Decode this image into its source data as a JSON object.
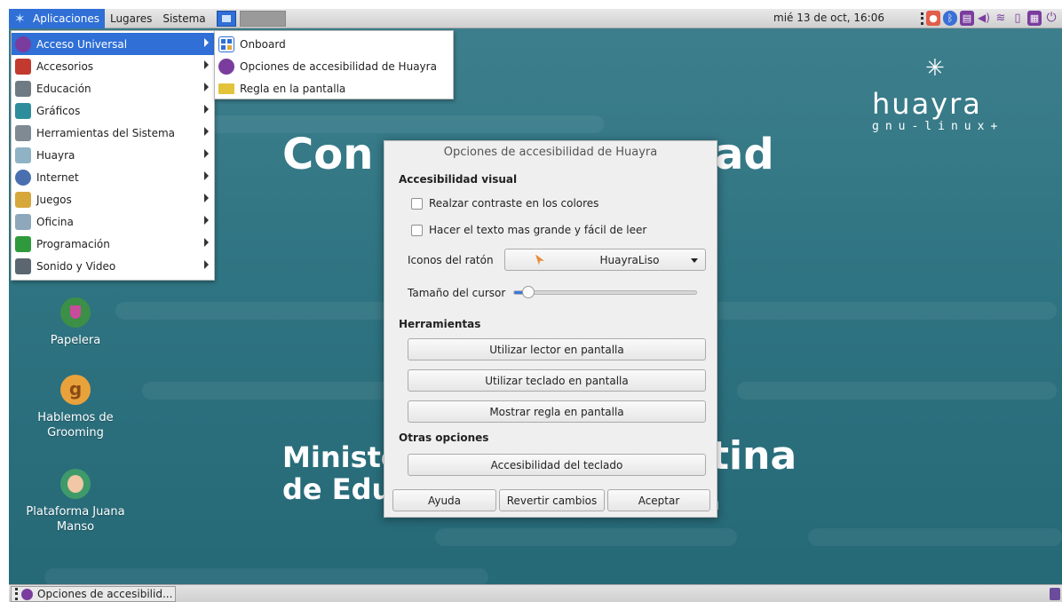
{
  "top_panel": {
    "menus": [
      "Aplicaciones",
      "Lugares",
      "Sistema"
    ],
    "clock": "mié 13 de oct, 16:06"
  },
  "desktop": {
    "banner_top_left": "Con",
    "banner_top_right": "ad",
    "banner_bottom_left_1": "Ministe",
    "banner_bottom_left_2": "de Edu",
    "banner_bottom_right": "tina",
    "banner_bottom_right_2": "a",
    "logo_word": "huayra",
    "logo_sub": "gnu-linux+",
    "icons": [
      {
        "label": "Papelera",
        "color": "#3c8f47"
      },
      {
        "label": "Hablemos de Grooming",
        "color": "#e9a23b"
      },
      {
        "label": "Plataforma Juana Manso",
        "color": "#3f9a6a"
      }
    ]
  },
  "apps_menu": {
    "items": [
      {
        "label": "Acceso Universal",
        "active": true,
        "icon": "universal-access-icon",
        "color": "#7a3d9e"
      },
      {
        "label": "Accesorios",
        "icon": "accessories-icon",
        "color": "#c23a2e"
      },
      {
        "label": "Educación",
        "icon": "education-icon",
        "color": "#6f7a83"
      },
      {
        "label": "Gráficos",
        "icon": "graphics-icon",
        "color": "#2e8d9a"
      },
      {
        "label": "Herramientas del Sistema",
        "icon": "system-tools-icon",
        "color": "#7f8a93"
      },
      {
        "label": "Huayra",
        "icon": "huayra-icon",
        "color": "#8fb3c4"
      },
      {
        "label": "Internet",
        "icon": "internet-icon",
        "color": "#4a6fb0"
      },
      {
        "label": "Juegos",
        "icon": "games-icon",
        "color": "#d6a83c"
      },
      {
        "label": "Oficina",
        "icon": "office-icon",
        "color": "#8fa7bb"
      },
      {
        "label": "Programación",
        "icon": "programming-icon",
        "color": "#2f9a3c"
      },
      {
        "label": "Sonido y Video",
        "icon": "sound-video-icon",
        "color": "#5b6670"
      }
    ]
  },
  "submenu": {
    "items": [
      {
        "label": "Onboard",
        "icon": "onboard-icon"
      },
      {
        "label": "Opciones de accesibilidad de Huayra",
        "icon": "accessibility-icon"
      },
      {
        "label": "Regla en la pantalla",
        "icon": "ruler-icon"
      }
    ]
  },
  "dialog": {
    "title": "Opciones de accesibilidad de Huayra",
    "section_visual": "Accesibilidad visual",
    "check_contrast": "Realzar contraste en los colores",
    "check_text": "Hacer el texto mas grande y fácil de leer",
    "mouse_icons_label": "Iconos del ratón",
    "mouse_icons_value": "HuayraLiso",
    "cursor_size_label": "Tamaño del cursor",
    "cursor_size_value": 0.08,
    "section_tools": "Herramientas",
    "btn_reader": "Utilizar lector en pantalla",
    "btn_keyboard": "Utilizar teclado en pantalla",
    "btn_ruler": "Mostrar regla en pantalla",
    "section_other": "Otras opciones",
    "btn_kbd_access": "Accesibilidad del teclado",
    "btn_help": "Ayuda",
    "btn_revert": "Revertir cambios",
    "btn_accept": "Aceptar"
  },
  "taskbar": {
    "task_label": "Opciones de accesibilid..."
  }
}
